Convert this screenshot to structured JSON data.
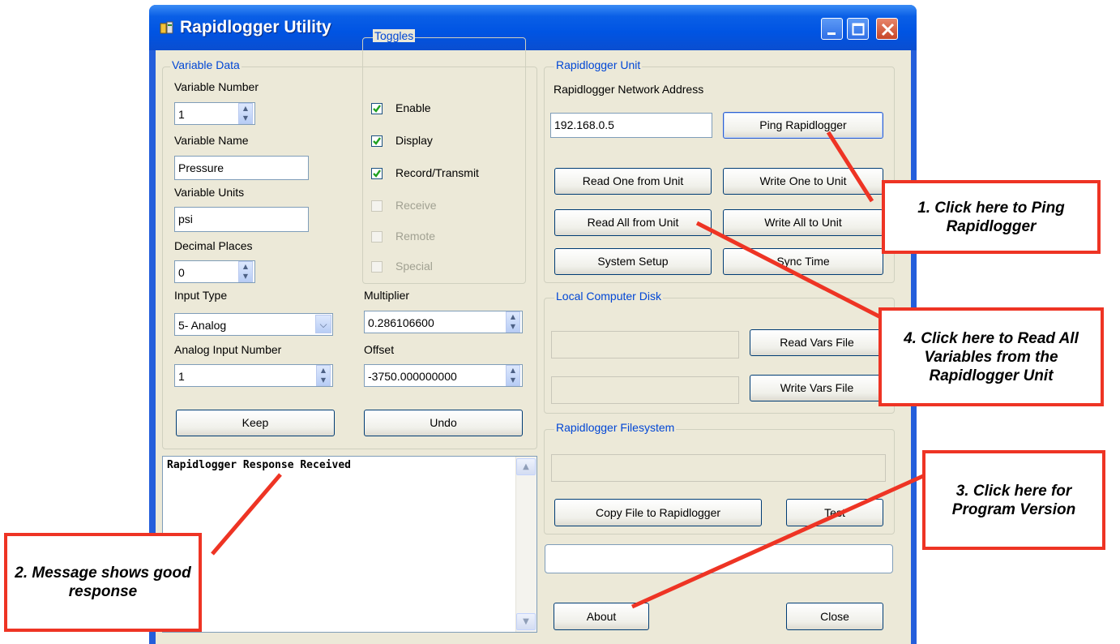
{
  "window": {
    "title": "Rapidlogger Utility",
    "title_color": "#0054e3"
  },
  "variable_data": {
    "legend": "Variable Data",
    "variable_number_label": "Variable Number",
    "variable_number": "1",
    "variable_name_label": "Variable Name",
    "variable_name": "Pressure",
    "variable_units_label": "Variable Units",
    "variable_units": "psi",
    "decimal_places_label": "Decimal Places",
    "decimal_places": "0",
    "input_type_label": "Input Type",
    "input_type": "5- Analog",
    "analog_input_label": "Analog Input Number",
    "analog_input": "1",
    "multiplier_label": "Multiplier",
    "multiplier": "0.286106600",
    "offset_label": "Offset",
    "offset": "-3750.000000000",
    "keep_label": "Keep",
    "undo_label": "Undo"
  },
  "toggles": {
    "legend": "Toggles",
    "items": [
      {
        "label": "Enable",
        "checked": true,
        "enabled": true
      },
      {
        "label": "Display",
        "checked": true,
        "enabled": true
      },
      {
        "label": "Record/Transmit",
        "checked": true,
        "enabled": true
      },
      {
        "label": "Receive",
        "checked": false,
        "enabled": false
      },
      {
        "label": "Remote",
        "checked": false,
        "enabled": false
      },
      {
        "label": "Special",
        "checked": false,
        "enabled": false
      }
    ]
  },
  "unit": {
    "legend": "Rapidlogger Unit",
    "address_label": "Rapidlogger Network Address",
    "address": "192.168.0.5",
    "ping_label": "Ping Rapidlogger",
    "read_one_label": "Read One from Unit",
    "write_one_label": "Write One to Unit",
    "read_all_label": "Read All from Unit",
    "write_all_label": "Write All to Unit",
    "system_setup_label": "System Setup",
    "sync_time_label": "Sync Time"
  },
  "local_disk": {
    "legend": "Local Computer Disk",
    "read_vars_label": "Read Vars File",
    "write_vars_label": "Write Vars File"
  },
  "filesystem": {
    "legend": "Rapidlogger Filesystem",
    "copy_label": "Copy File to Rapidlogger",
    "test_label": "Test"
  },
  "message": {
    "text": "Rapidlogger Response Received"
  },
  "footer": {
    "about_label": "About",
    "close_label": "Close"
  },
  "callouts": {
    "c1": "1. Click here to Ping Rapidlogger",
    "c2": "2. Message shows good response",
    "c3": "3. Click here for Program Version",
    "c4": "4. Click here to Read All Variables from the Rapidlogger Unit",
    "accent": "#ee3424"
  }
}
